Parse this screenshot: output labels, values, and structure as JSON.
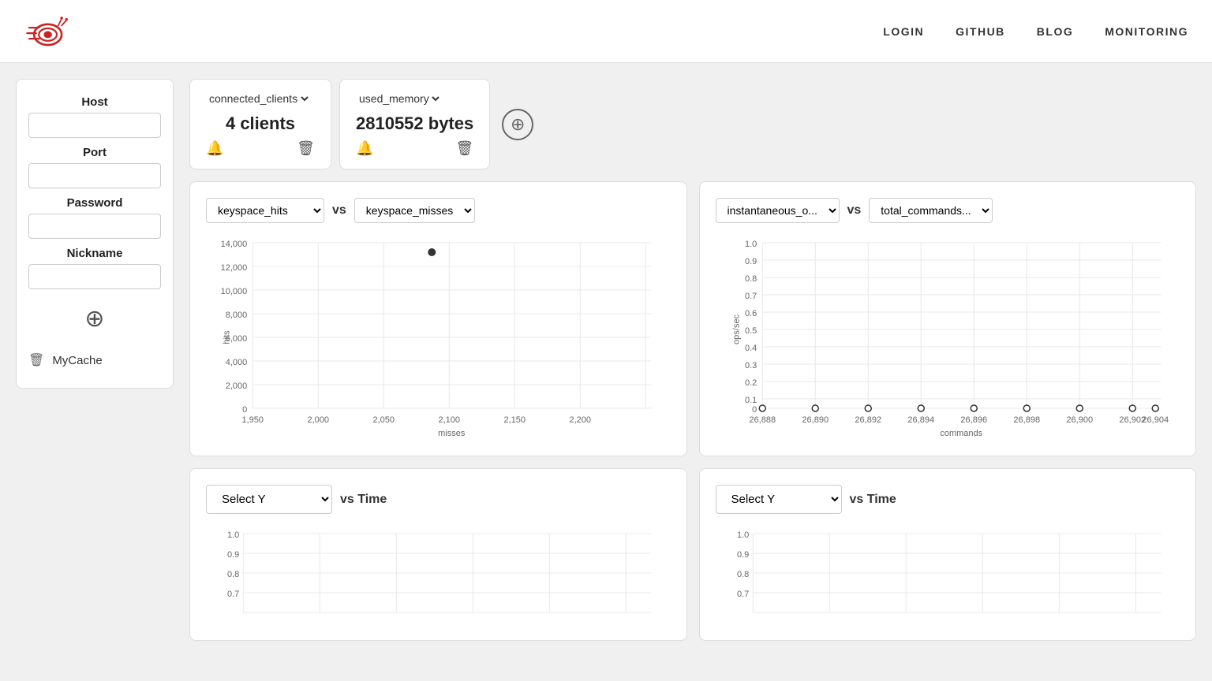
{
  "header": {
    "nav": [
      {
        "label": "LOGIN",
        "key": "login"
      },
      {
        "label": "GITHUB",
        "key": "github"
      },
      {
        "label": "BLOG",
        "key": "blog"
      },
      {
        "label": "MONITORING",
        "key": "monitoring"
      }
    ]
  },
  "sidebar": {
    "host_label": "Host",
    "host_placeholder": "",
    "port_label": "Port",
    "port_placeholder": "",
    "password_label": "Password",
    "password_placeholder": "",
    "nickname_label": "Nickname",
    "nickname_placeholder": "",
    "add_icon": "⊕",
    "cache_items": [
      {
        "name": "MyCache"
      }
    ]
  },
  "widgets": [
    {
      "metric": "connected_clients",
      "value": "4 clients"
    },
    {
      "metric": "used_memory",
      "value": "2810552 bytes"
    }
  ],
  "scatter_charts": [
    {
      "x_metric": "keyspace_misses",
      "y_metric": "keyspace_hits",
      "x_label": "misses",
      "y_label": "hits",
      "x_range": [
        1950,
        2200
      ],
      "y_range": [
        0,
        14000
      ],
      "x_ticks": [
        1950,
        2000,
        2050,
        2100,
        2150,
        2200
      ],
      "y_ticks": [
        0,
        2000,
        4000,
        6000,
        8000,
        10000,
        12000,
        14000
      ],
      "data_point": {
        "x": 2068,
        "y": 13000
      }
    },
    {
      "x_metric": "total_commands...",
      "y_metric": "instantaneous_o...",
      "x_label": "commands",
      "y_label": "ops/sec",
      "x_range": [
        26888,
        26904
      ],
      "y_range": [
        0,
        1.0
      ],
      "x_ticks": [
        26888,
        26890,
        26892,
        26894,
        26896,
        26898,
        26900,
        26902,
        26904
      ],
      "y_ticks": [
        0,
        0.1,
        0.2,
        0.3,
        0.4,
        0.5,
        0.6,
        0.7,
        0.8,
        0.9,
        1.0
      ],
      "data_points": [
        {
          "x": 26888,
          "y": 0
        },
        {
          "x": 26890,
          "y": 0
        },
        {
          "x": 26892,
          "y": 0
        },
        {
          "x": 26894,
          "y": 0
        },
        {
          "x": 26896,
          "y": 0
        },
        {
          "x": 26898,
          "y": 0
        },
        {
          "x": 26900,
          "y": 0
        },
        {
          "x": 26902,
          "y": 0
        },
        {
          "x": 26904,
          "y": 0
        }
      ]
    }
  ],
  "time_charts": [
    {
      "select_placeholder": "Select Y",
      "vs_label": "vs Time",
      "y_ticks": [
        0.7,
        0.8,
        0.9,
        1.0
      ]
    },
    {
      "select_placeholder": "Select Y",
      "vs_label": "vs Time",
      "y_ticks": [
        0.7,
        0.8,
        0.9,
        1.0
      ]
    }
  ]
}
